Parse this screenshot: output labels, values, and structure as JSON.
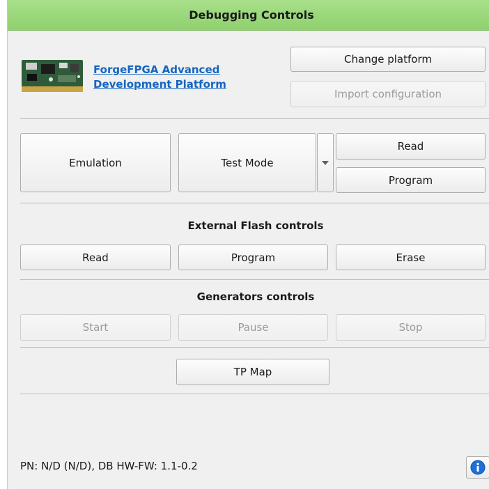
{
  "panel": {
    "title": "Debugging Controls"
  },
  "platform": {
    "link_line1": "ForgeFPGA Advanced",
    "link_line2": "Development Platform",
    "change_label": "Change platform",
    "import_label": "Import configuration"
  },
  "mode": {
    "emulation_label": "Emulation",
    "test_mode_label": "Test Mode",
    "read_label": "Read",
    "program_label": "Program"
  },
  "flash": {
    "title": "External Flash controls",
    "read_label": "Read",
    "program_label": "Program",
    "erase_label": "Erase"
  },
  "generators": {
    "title": "Generators controls",
    "start_label": "Start",
    "pause_label": "Pause",
    "stop_label": "Stop"
  },
  "tp_map_label": "TP Map",
  "footer": {
    "status": "PN: N/D (N/D), DB HW-FW: 1.1-0.2"
  },
  "colors": {
    "header": "#a9df8a",
    "link": "#1565c0",
    "info": "#1e6fd9"
  },
  "icons": [
    "board-image",
    "chevron-down-icon",
    "info-icon"
  ]
}
